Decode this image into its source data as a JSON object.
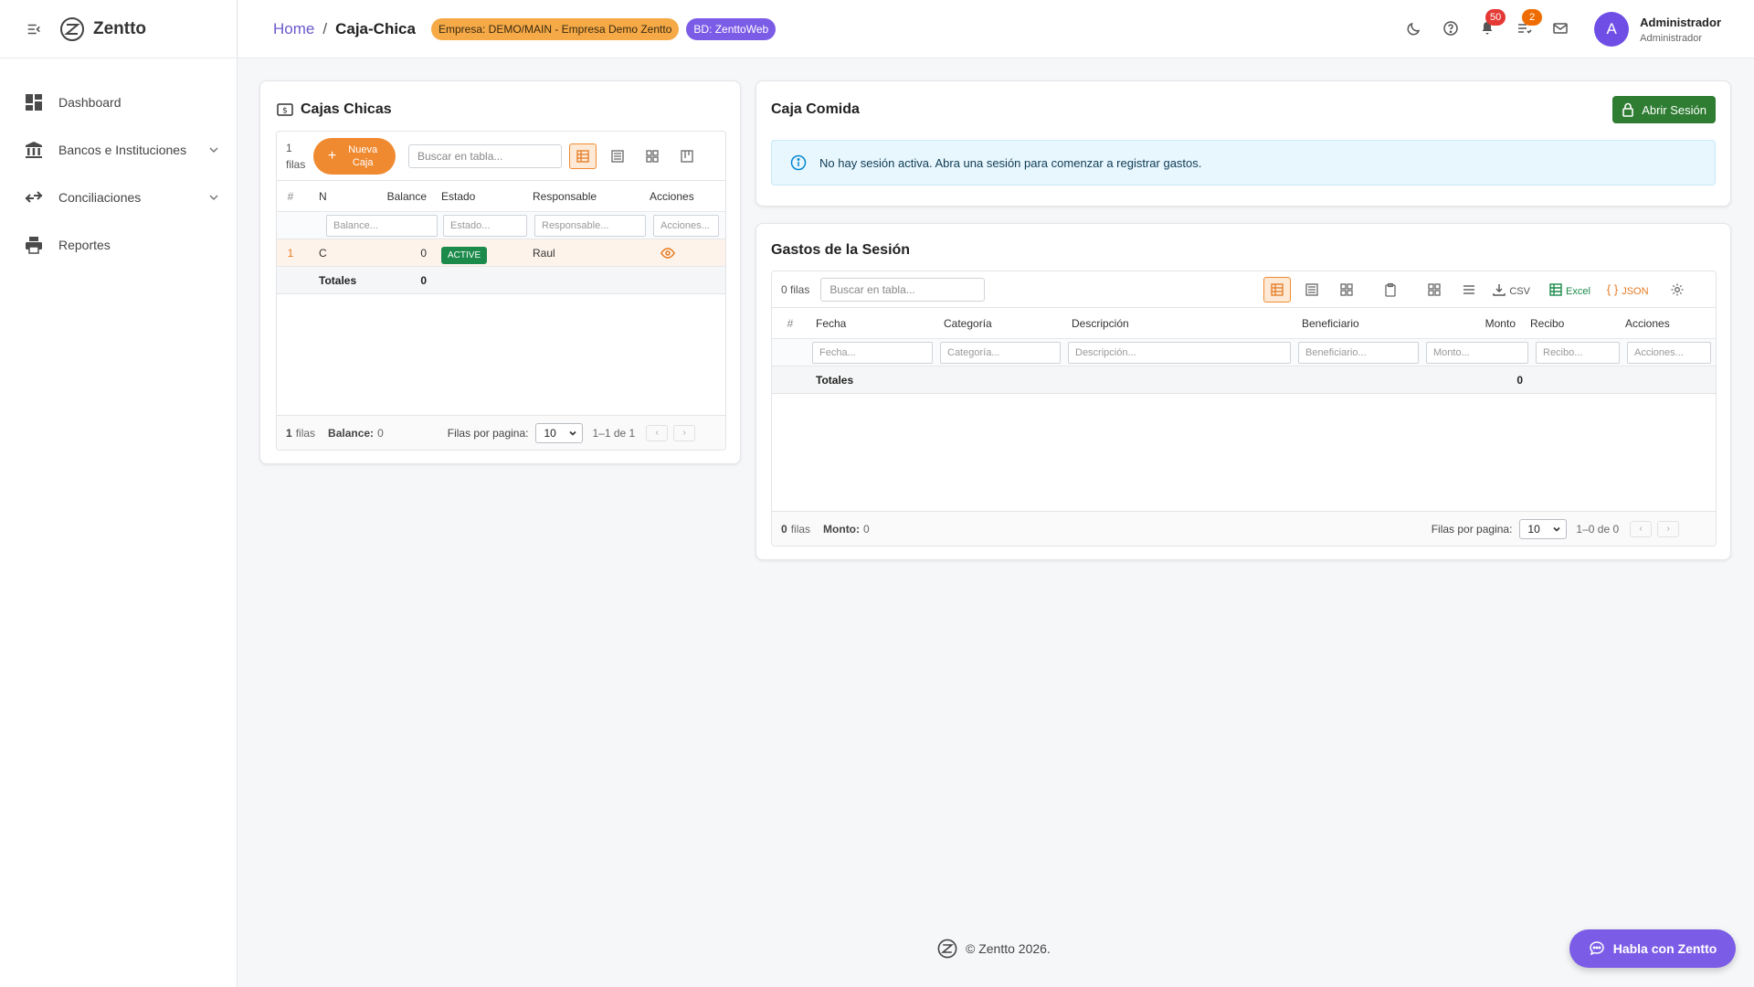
{
  "app": {
    "name": "Zentto"
  },
  "sidebar": {
    "items": [
      {
        "label": "Dashboard",
        "icon": "dashboard-icon",
        "expandable": false
      },
      {
        "label": "Bancos e Instituciones",
        "icon": "bank-icon",
        "expandable": true
      },
      {
        "label": "Conciliaciones",
        "icon": "compare-arrows-icon",
        "expandable": true
      },
      {
        "label": "Reportes",
        "icon": "printer-icon",
        "expandable": false
      }
    ]
  },
  "header": {
    "breadcrumb": {
      "home": "Home",
      "separator": "/",
      "current": "Caja-Chica"
    },
    "empresa_badge": "Empresa: DEMO/MAIN - Empresa Demo Zentto",
    "bd_badge": "BD: ZenttoWeb",
    "notifications_count": "50",
    "tasks_count": "2",
    "user_initial": "A",
    "user_name": "Administrador",
    "user_role": "Administrador"
  },
  "colors": {
    "accent": "#7b5ce6",
    "orange": "#f08a30",
    "green": "#2e7d32",
    "active_badge": "#1b8a4a",
    "notif_red": "#e53935",
    "notif_orange": "#ef6c00"
  },
  "cajas": {
    "title": "Cajas Chicas",
    "rows_count": "1",
    "rows_word": "filas",
    "new_button": "Nueva Caja",
    "search_placeholder": "Buscar en tabla...",
    "columns": [
      "#",
      "N",
      "Balance",
      "Estado",
      "Responsable",
      "Acciones"
    ],
    "filters": [
      "",
      "Balance...",
      "Estado...",
      "Responsable...",
      "Acciones..."
    ],
    "rows": [
      {
        "num": "1",
        "nombre": "C",
        "balance": "0",
        "estado": "ACTIVE",
        "responsable": "Raul"
      }
    ],
    "totals_label": "Totales",
    "totals_balance": "0",
    "footer": {
      "count": "1",
      "filas": "filas",
      "balance_label": "Balance:",
      "balance_value": "0",
      "per_page_label": "Filas por pagina:",
      "per_page": "10",
      "range": "1–1 de 1"
    }
  },
  "caja_comida": {
    "title": "Caja Comida",
    "open_button": "Abrir Sesión",
    "alert": "No hay sesión activa. Abra una sesión para comenzar a registrar gastos."
  },
  "gastos": {
    "title": "Gastos de la Sesión",
    "rows_count": "0 filas",
    "search_placeholder": "Buscar en tabla...",
    "export_csv": "CSV",
    "export_excel": "Excel",
    "export_json": "JSON",
    "columns": [
      "#",
      "Fecha",
      "Categoría",
      "Descripción",
      "Beneficiario",
      "Monto",
      "Recibo",
      "Acciones"
    ],
    "filters": [
      "Fecha...",
      "Categoría...",
      "Descripción...",
      "Beneficiario...",
      "Monto...",
      "Recibo...",
      "Acciones..."
    ],
    "totals_label": "Totales",
    "totals_monto": "0",
    "footer": {
      "count": "0",
      "filas": "filas",
      "monto_label": "Monto:",
      "monto_value": "0",
      "per_page_label": "Filas por pagina:",
      "per_page": "10",
      "range": "1–0 de 0"
    }
  },
  "footer": {
    "text": "© Zentto 2026."
  },
  "chat": {
    "label": "Habla con Zentto"
  }
}
